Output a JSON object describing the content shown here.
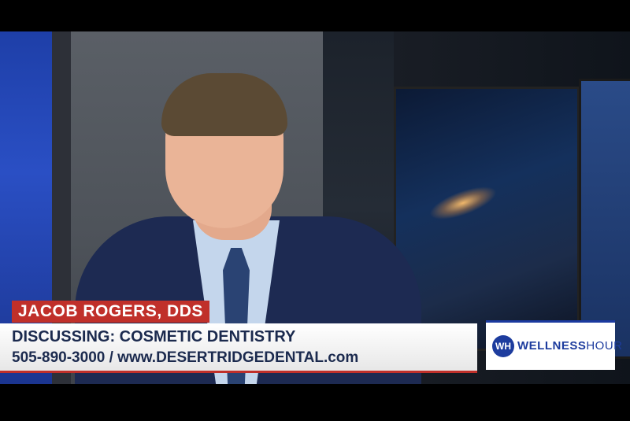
{
  "lower_third": {
    "name": "JACOB ROGERS, DDS",
    "topic": "DISCUSSING: COSMETIC DENTISTRY",
    "contact": "505-890-3000 / www.DESERTRIDGEDENTAL.com"
  },
  "logo": {
    "mark": "WH",
    "text_bold": "WELLNESS",
    "text_light": "HOUR"
  },
  "colors": {
    "accent_red": "#c0302a",
    "brand_blue": "#1d3c9e",
    "text_navy": "#1b2a4e"
  }
}
